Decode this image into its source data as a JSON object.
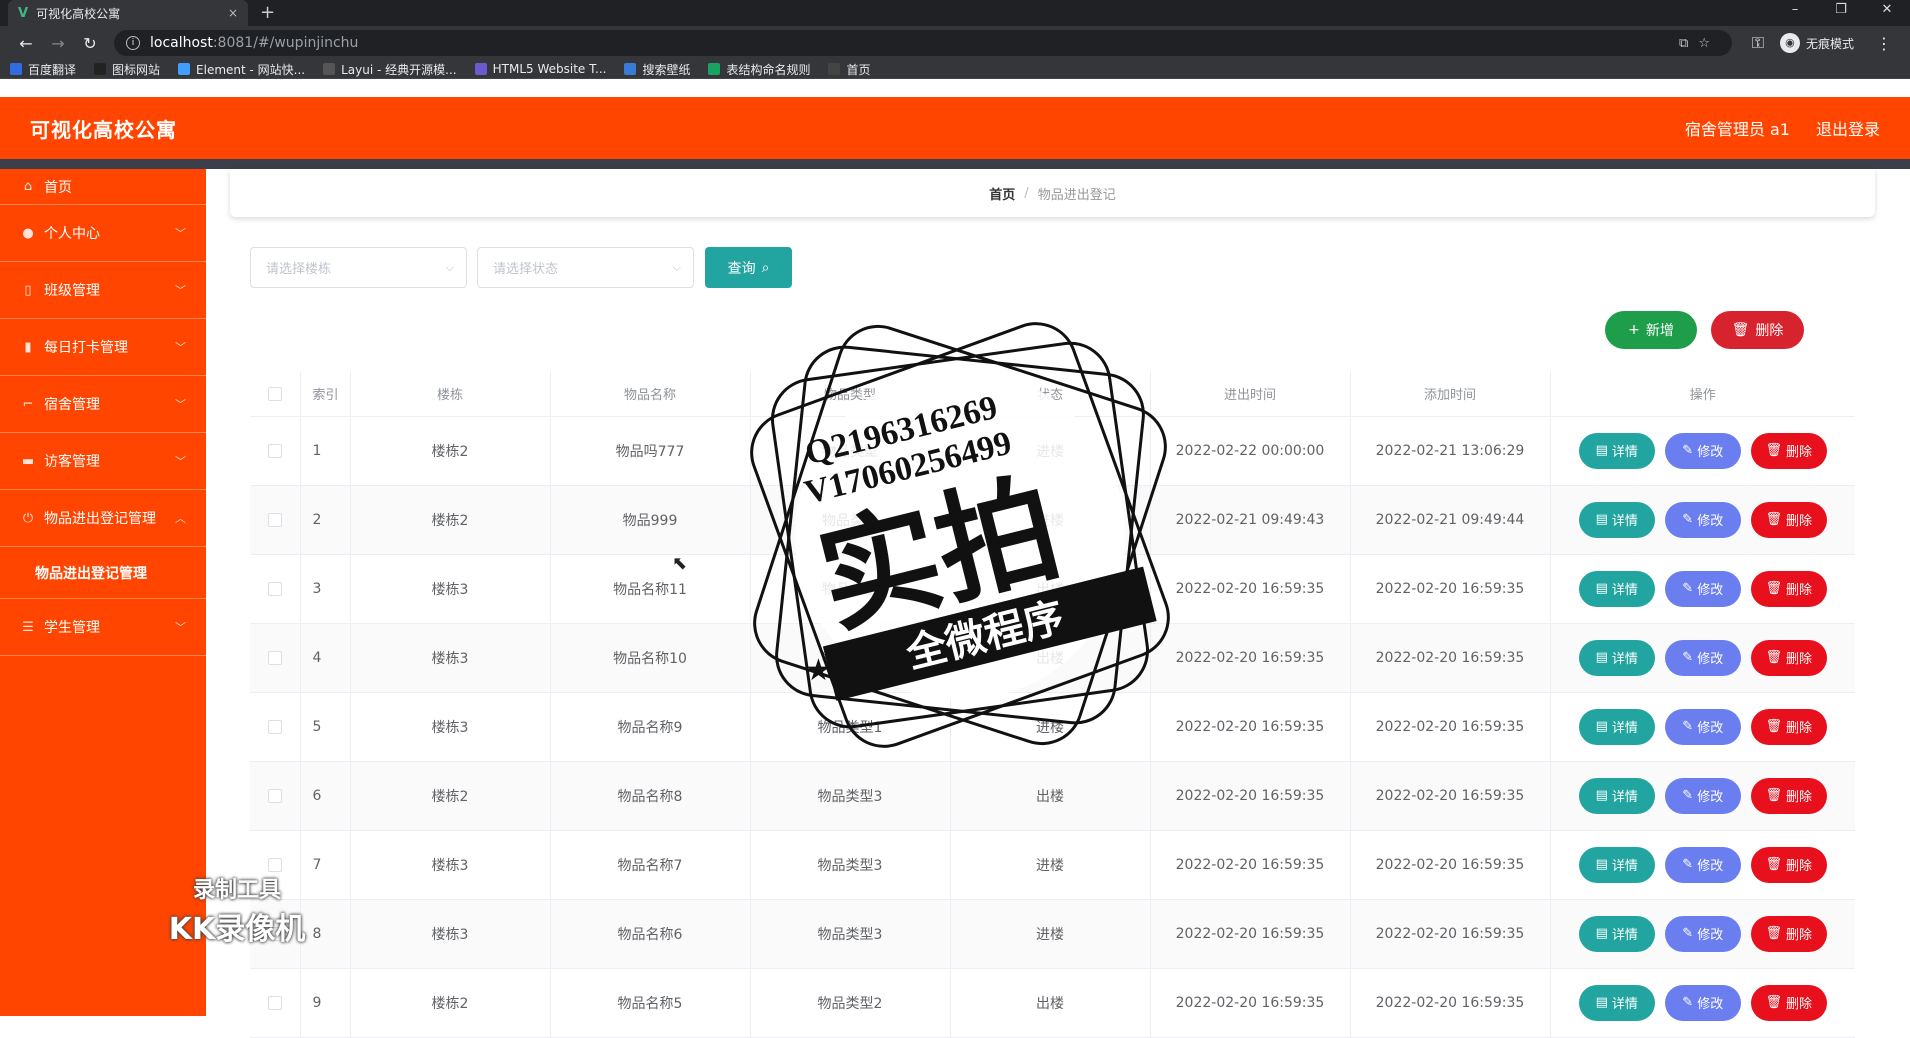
{
  "browser": {
    "tab_title": "可视化高校公寓",
    "tab_close": "×",
    "new_tab": "+",
    "url_host": "localhost",
    "url_path": ":8081/#/wupinjinchu",
    "incognito_label": "无痕模式",
    "bookmarks": [
      {
        "label": "百度翻译",
        "color": "#2f6de1"
      },
      {
        "label": "图标网站",
        "color": "#222222"
      },
      {
        "label": "Element - 网站快...",
        "color": "#409eff"
      },
      {
        "label": "Layui - 经典开源模...",
        "color": "#555555"
      },
      {
        "label": "HTML5 Website T...",
        "color": "#6a5acd"
      },
      {
        "label": "搜索壁纸",
        "color": "#3a7bd5"
      },
      {
        "label": "表结构命名规则",
        "color": "#1aa260"
      },
      {
        "label": "首页",
        "color": "#444444"
      }
    ]
  },
  "header": {
    "title": "可视化高校公寓",
    "user": "宿舍管理员 a1",
    "logout": "退出登录"
  },
  "sidebar": {
    "items": [
      {
        "label": "首页",
        "icon": "home-icon",
        "glyph": "⌂",
        "has_children": false
      },
      {
        "label": "个人中心",
        "icon": "user-icon",
        "glyph": "●",
        "has_children": true
      },
      {
        "label": "班级管理",
        "icon": "phone-icon",
        "glyph": "▯",
        "has_children": true
      },
      {
        "label": "每日打卡管理",
        "icon": "bar-chart-icon",
        "glyph": "▮",
        "has_children": true
      },
      {
        "label": "宿舍管理",
        "icon": "crop-icon",
        "glyph": "⌐",
        "has_children": true
      },
      {
        "label": "访客管理",
        "icon": "monitor-icon",
        "glyph": "▬",
        "has_children": true
      },
      {
        "label": "物品进出登记管理",
        "icon": "power-icon",
        "glyph": "⏻",
        "has_children": true,
        "expanded": true
      },
      {
        "label": "学生管理",
        "icon": "list-icon",
        "glyph": "☰",
        "has_children": true
      }
    ],
    "submenu_label": "物品进出登记管理"
  },
  "breadcrumb": {
    "home": "首页",
    "separator": "/",
    "current": "物品进出登记"
  },
  "filters": {
    "building_placeholder": "请选择楼栋",
    "status_placeholder": "请选择状态",
    "search_label": "查询"
  },
  "actions": {
    "add_label": "新增",
    "delete_label": "删除"
  },
  "table": {
    "headers": [
      "索引",
      "楼栋",
      "物品名称",
      "物品类型",
      "状态",
      "进出时间",
      "添加时间",
      "操作"
    ],
    "rows": [
      {
        "index": "1",
        "building": "楼栋2",
        "name": "物品吗777",
        "type": "物品类型",
        "status": "进楼",
        "in_out_time": "2022-02-22 00:00:00",
        "add_time": "2022-02-21 13:06:29"
      },
      {
        "index": "2",
        "building": "楼栋2",
        "name": "物品999",
        "type": "物品类型",
        "status": "进楼",
        "in_out_time": "2022-02-21 09:49:43",
        "add_time": "2022-02-21 09:49:44"
      },
      {
        "index": "3",
        "building": "楼栋3",
        "name": "物品名称11",
        "type": "物品类型",
        "status": "出楼",
        "in_out_time": "2022-02-20 16:59:35",
        "add_time": "2022-02-20 16:59:35"
      },
      {
        "index": "4",
        "building": "楼栋3",
        "name": "物品名称10",
        "type": "物品类型",
        "status": "出楼",
        "in_out_time": "2022-02-20 16:59:35",
        "add_time": "2022-02-20 16:59:35"
      },
      {
        "index": "5",
        "building": "楼栋3",
        "name": "物品名称9",
        "type": "物品类型1",
        "status": "进楼",
        "in_out_time": "2022-02-20 16:59:35",
        "add_time": "2022-02-20 16:59:35"
      },
      {
        "index": "6",
        "building": "楼栋2",
        "name": "物品名称8",
        "type": "物品类型3",
        "status": "出楼",
        "in_out_time": "2022-02-20 16:59:35",
        "add_time": "2022-02-20 16:59:35"
      },
      {
        "index": "7",
        "building": "楼栋3",
        "name": "物品名称7",
        "type": "物品类型3",
        "status": "进楼",
        "in_out_time": "2022-02-20 16:59:35",
        "add_time": "2022-02-20 16:59:35"
      },
      {
        "index": "8",
        "building": "楼栋3",
        "name": "物品名称6",
        "type": "物品类型3",
        "status": "进楼",
        "in_out_time": "2022-02-20 16:59:35",
        "add_time": "2022-02-20 16:59:35"
      },
      {
        "index": "9",
        "building": "楼栋2",
        "name": "物品名称5",
        "type": "物品类型2",
        "status": "出楼",
        "in_out_time": "2022-02-20 16:59:35",
        "add_time": "2022-02-20 16:59:35"
      }
    ],
    "op_detail": "详情",
    "op_edit": "修改",
    "op_delete": "删除"
  },
  "overlays": {
    "stamp_line1": "Q2196316269",
    "stamp_line2": "V17060256499",
    "stamp_main": "实拍",
    "stamp_banner": "全微程序",
    "recorder_line1": "录制工具",
    "recorder_line2": "KK录像机"
  },
  "colors": {
    "brand": "#ff4500",
    "teal": "#22a5a1",
    "green": "#1e9e4a",
    "red": "#d7232e",
    "purple": "#6a7ef0"
  }
}
